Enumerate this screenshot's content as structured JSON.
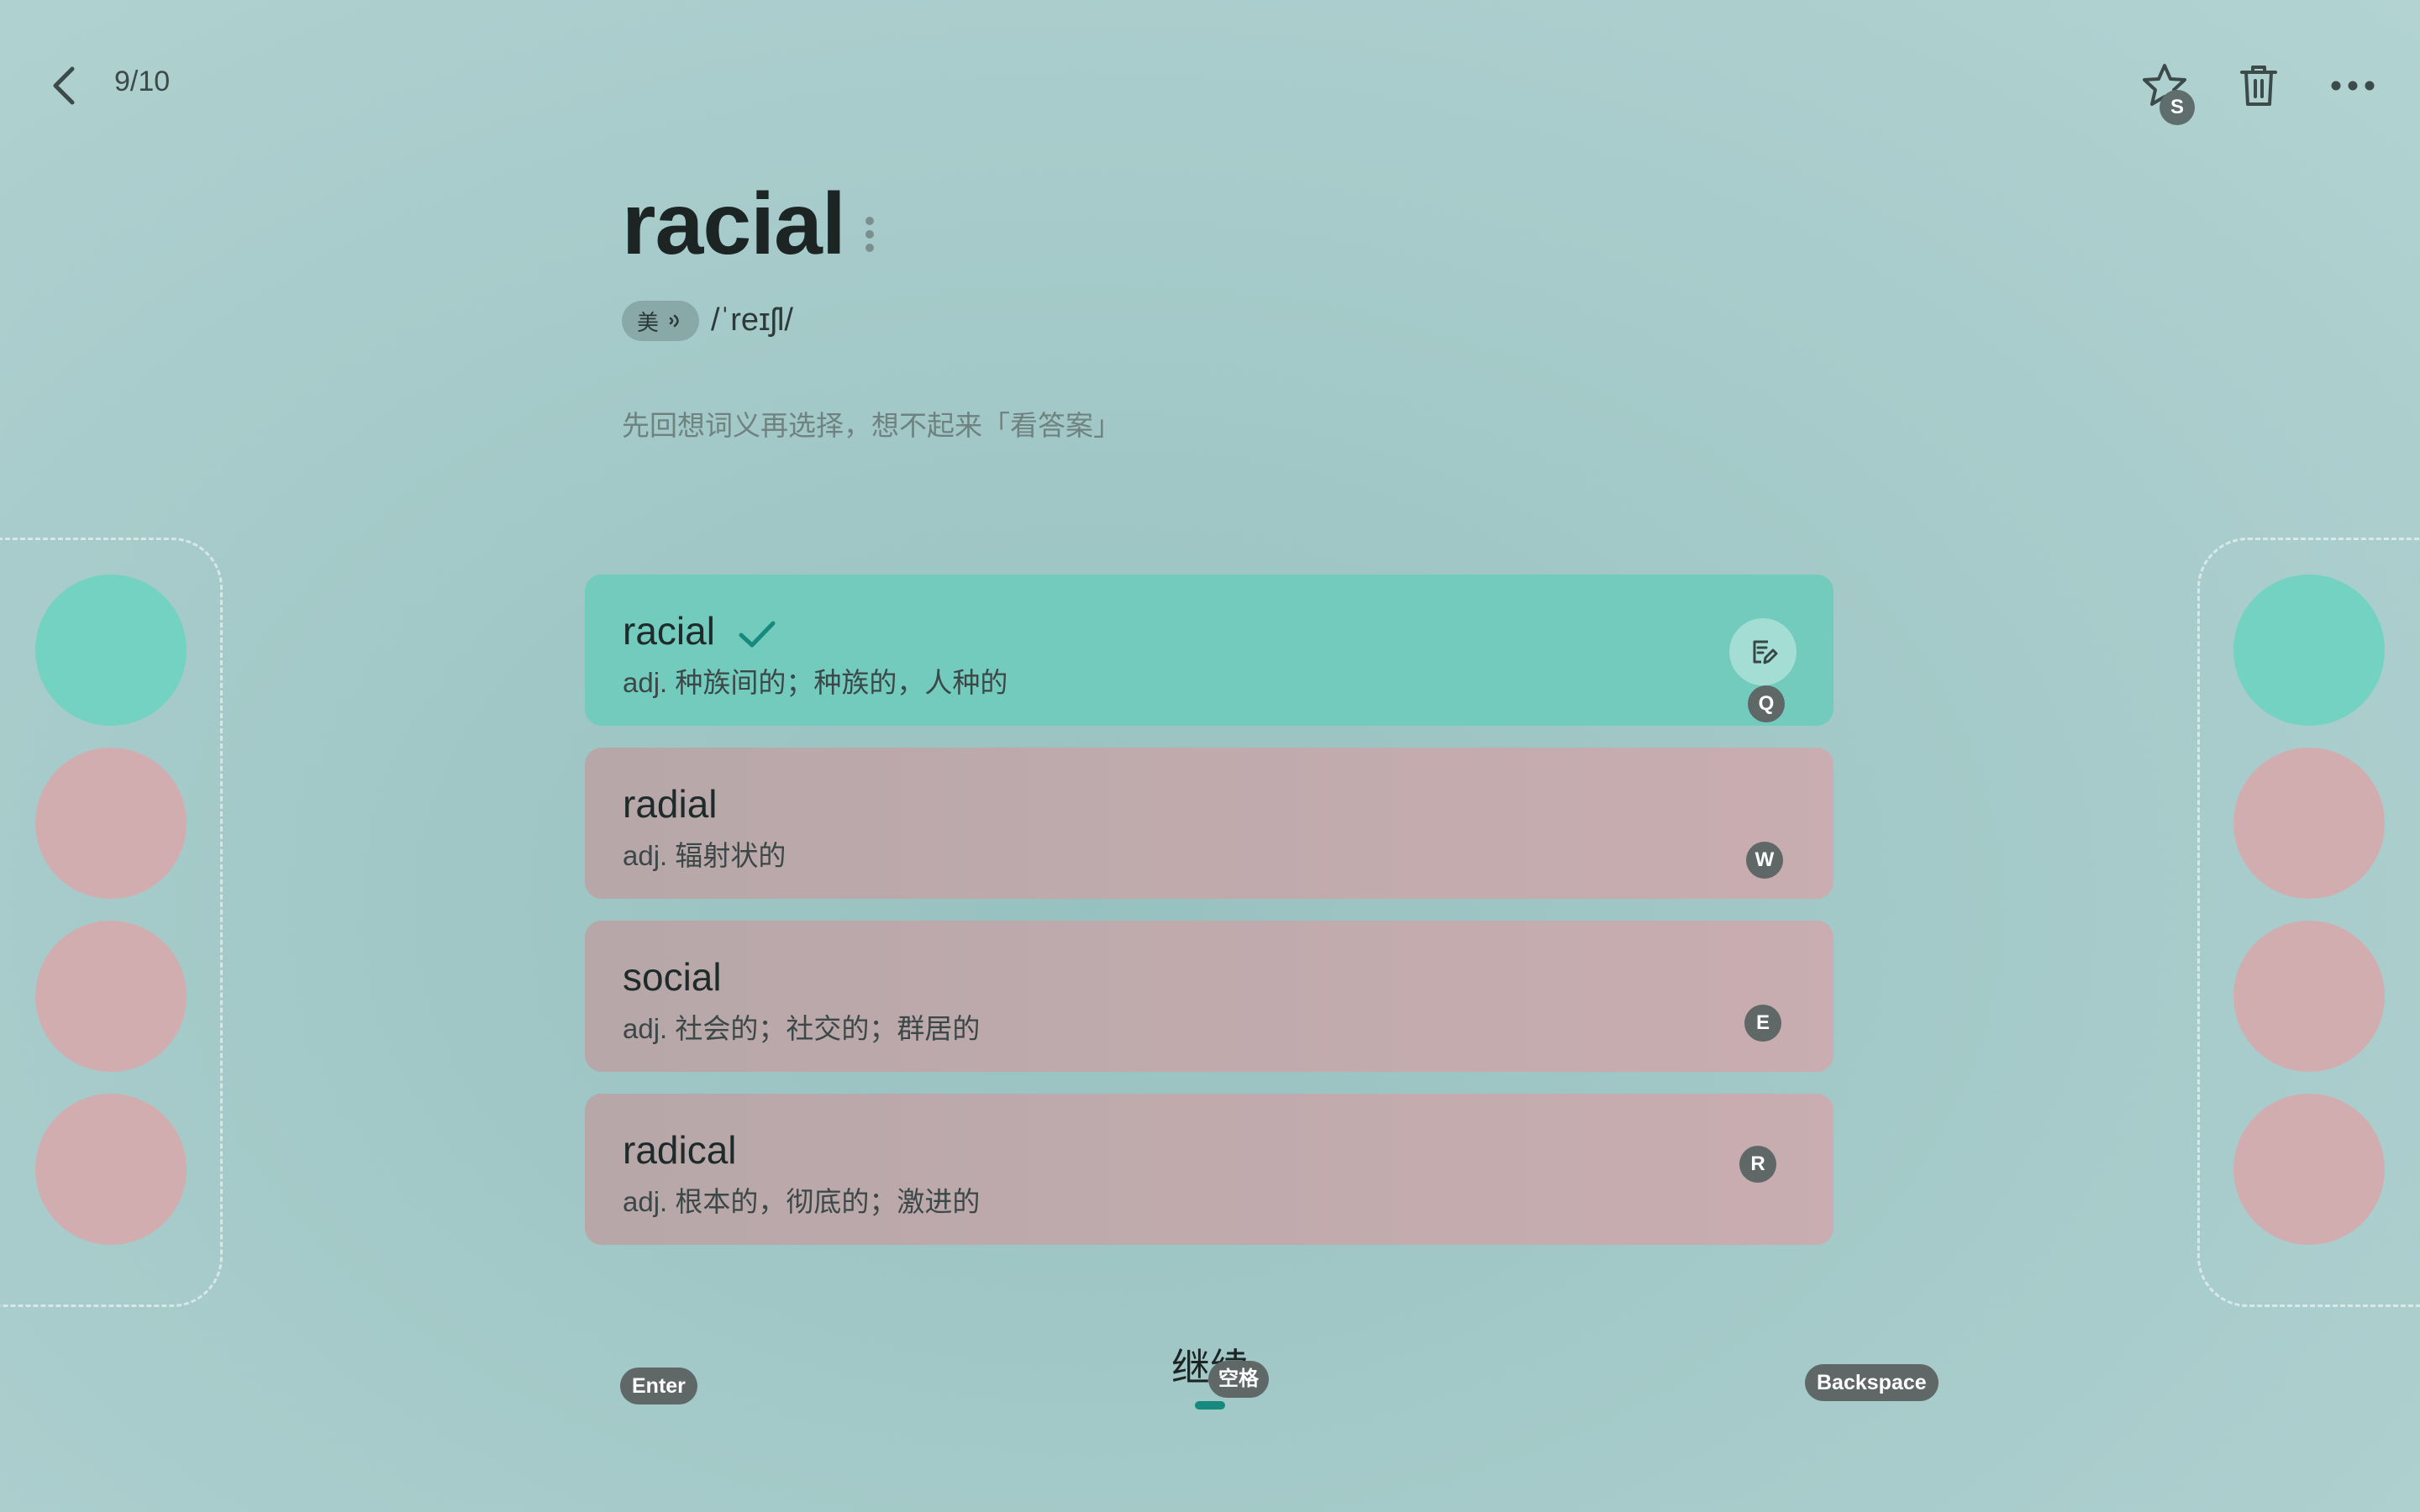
{
  "header": {
    "progress": "9/10",
    "star_key": "S"
  },
  "word": {
    "text": "racial",
    "accent_label": "美",
    "phonetic": "/ˈreɪʃl/",
    "hint": "先回想词义再选择，想不起来「看答案」"
  },
  "options": [
    {
      "word": "racial",
      "definition": "adj. 种族间的；种族的，人种的",
      "key": "Q",
      "state": "correct"
    },
    {
      "word": "radial",
      "definition": "adj. 辐射状的",
      "key": "W",
      "state": "wrong"
    },
    {
      "word": "social",
      "definition": "adj. 社会的；社交的；群居的",
      "key": "E",
      "state": "wrong"
    },
    {
      "word": "radical",
      "definition": "adj. 根本的，彻底的；激进的",
      "key": "R",
      "state": "wrong"
    }
  ],
  "footer": {
    "enter_key": "Enter",
    "continue_label": "继续",
    "space_key": "空格",
    "backspace_key": "Backspace"
  },
  "colors": {
    "correct": "#72cbbd",
    "wrong": "#c9adb0",
    "accent": "#178a7e"
  },
  "icons": [
    "chevron-left-icon",
    "star-icon",
    "trash-icon",
    "more-horizontal-icon",
    "speaker-icon",
    "check-icon",
    "edit-note-icon"
  ]
}
